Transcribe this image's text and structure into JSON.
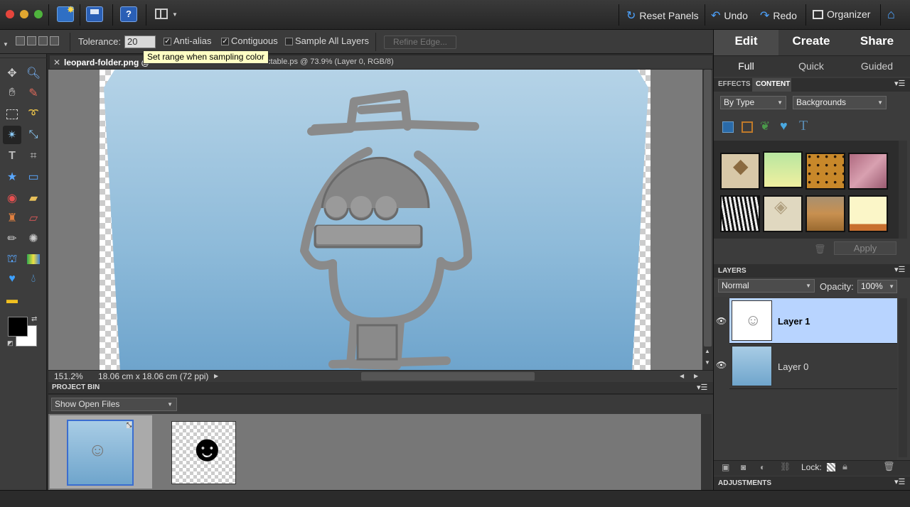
{
  "toolbar": {
    "reset_panels": "Reset Panels",
    "undo": "Undo",
    "redo": "Redo",
    "organizer": "Organizer"
  },
  "options": {
    "tolerance_label": "Tolerance:",
    "tolerance_value": "20",
    "anti_alias": "Anti-alias",
    "contiguous": "Contiguous",
    "sample_all_layers": "Sample All Layers",
    "refine_edge": "Refine Edge...",
    "tooltip": "Set range when sampling color"
  },
  "document": {
    "tab_file": "leopard-folder.png @",
    "tab_file2": "ctable.ps @ 73.9% (Layer 0, RGB/8)",
    "zoom": "151.2%",
    "size": "18.06 cm x 18.06 cm (72 ppi)"
  },
  "project_bin": {
    "title": "PROJECT BIN",
    "show": "Show Open Files"
  },
  "modes": {
    "edit": "Edit",
    "create": "Create",
    "share": "Share",
    "full": "Full",
    "quick": "Quick",
    "guided": "Guided"
  },
  "content_panel": {
    "tab_effects": "EFFECTS",
    "tab_content": "CONTENT",
    "by_type": "By Type",
    "category": "Backgrounds",
    "apply": "Apply"
  },
  "layers_panel": {
    "title": "LAYERS",
    "blend_mode": "Normal",
    "opacity_label": "Opacity:",
    "opacity_value": "100%",
    "layers": [
      {
        "name": "Layer 1"
      },
      {
        "name": "Layer 0"
      }
    ],
    "lock_label": "Lock:"
  },
  "adjustments": {
    "title": "ADJUSTMENTS"
  }
}
